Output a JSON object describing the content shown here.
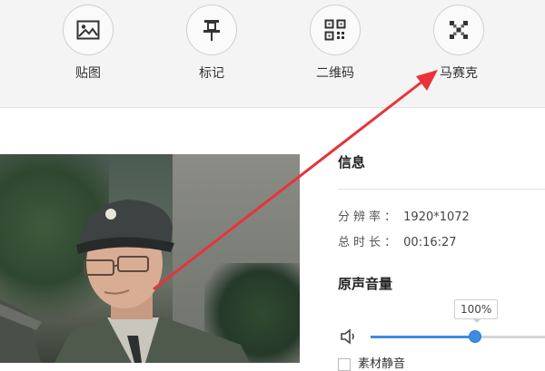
{
  "toolbar": {
    "tools": [
      {
        "label": "贴图",
        "icon": "image-icon"
      },
      {
        "label": "标记",
        "icon": "pin-icon"
      },
      {
        "label": "二维码",
        "icon": "qr-code-icon"
      },
      {
        "label": "马赛克",
        "icon": "mosaic-icon"
      }
    ]
  },
  "info": {
    "title": "信息",
    "resolution_label": "分辨率：",
    "resolution_value": "1920*1072",
    "duration_label": "总时长：",
    "duration_value": "00:16:27"
  },
  "audio": {
    "title": "原声音量",
    "volume_text": "100%",
    "volume_level": 0.6,
    "mute_label": "素材静音"
  },
  "colors": {
    "accent": "#3b8de0",
    "annotation_arrow": "#e8333a"
  }
}
